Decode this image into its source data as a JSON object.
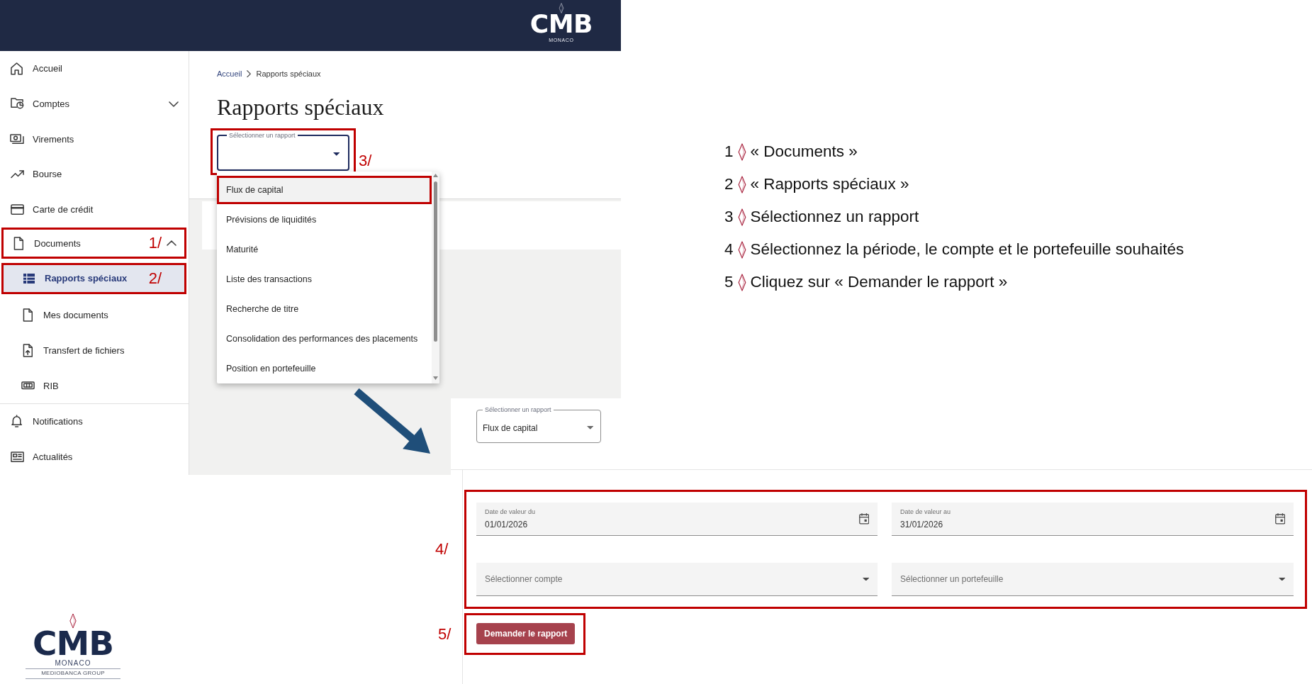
{
  "header": {
    "logo": {
      "wordmark": "CMB",
      "subtitle": "MONACO"
    }
  },
  "sidebar": {
    "sections": [
      {
        "items": [
          {
            "label": "Accueil",
            "selected": false
          },
          {
            "label": "Comptes",
            "selected": false,
            "expanded": false
          },
          {
            "label": "Virements",
            "selected": false
          },
          {
            "label": "Bourse",
            "selected": false
          },
          {
            "label": "Carte de crédit",
            "selected": false
          },
          {
            "label": "Documents",
            "selected": false,
            "expanded": true,
            "step_label": "1/",
            "children": [
              {
                "label": "Rapports spéciaux",
                "selected": true,
                "step_label": "2/"
              },
              {
                "label": "Mes documents",
                "selected": false
              },
              {
                "label": "Transfert de fichiers",
                "selected": false
              },
              {
                "label": "RIB",
                "selected": false
              }
            ]
          }
        ]
      },
      {
        "items": [
          {
            "label": "Notifications",
            "selected": false
          },
          {
            "label": "Actualités",
            "selected": false
          }
        ]
      }
    ]
  },
  "breadcrumb": [
    {
      "label": "Accueil"
    },
    {
      "label": "Rapports spéciaux"
    }
  ],
  "page_title": "Rapports spéciaux",
  "report_select": {
    "label": "Sélectionner un rapport",
    "focused": true,
    "step_label": "3/"
  },
  "report_menu": {
    "options": [
      {
        "label": "Flux de capital",
        "selected": true,
        "annotated": true
      },
      {
        "label": "Prévisions de liquidités",
        "selected": false,
        "annotated": false
      },
      {
        "label": "Maturité",
        "selected": false,
        "annotated": false
      },
      {
        "label": "Liste des transactions",
        "selected": false,
        "annotated": false
      },
      {
        "label": "Recherche de titre",
        "selected": false,
        "annotated": false
      },
      {
        "label": "Consolidation des performances des placements",
        "selected": false,
        "annotated": false
      },
      {
        "label": "Position en portefeuille",
        "selected": false,
        "annotated": false
      }
    ]
  },
  "result_panel": {
    "report_select": {
      "label": "Sélectionner un rapport",
      "value": "Flux de capital",
      "focused": false
    },
    "filters": {
      "step_label": "4/",
      "fields": [
        {
          "kind": "date",
          "label": "Date de valeur du",
          "value": "01/01/2026"
        },
        {
          "kind": "date",
          "label": "Date de valeur au",
          "value": "31/01/2026"
        },
        {
          "kind": "select",
          "placeholder": "Sélectionner compte"
        },
        {
          "kind": "select",
          "placeholder": "Sélectionner un portefeuille"
        }
      ]
    },
    "submit_button": {
      "label": "Demander le rapport",
      "step_label": "5/"
    }
  },
  "instructions": [
    {
      "number": "1",
      "text": "« Documents »"
    },
    {
      "number": "2",
      "text": "« Rapports spéciaux »"
    },
    {
      "number": "3",
      "text": "Sélectionnez un rapport"
    },
    {
      "number": "4",
      "text": "Sélectionnez la période, le compte et le portefeuille souhaités"
    },
    {
      "number": "5",
      "text": "Cliquez sur « Demander le rapport »"
    }
  ],
  "footer_logo": {
    "wordmark": "CMB",
    "subtitle": "MONACO",
    "tagline": "MEDIOBANCA GROUP"
  }
}
